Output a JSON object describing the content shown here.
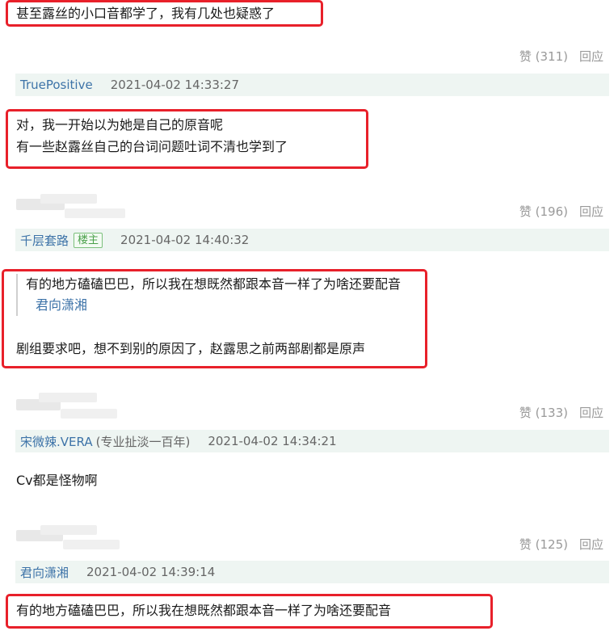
{
  "top_comment": {
    "text": "甚至露丝的小口音都学了，我有几处也疑惑了",
    "likes": "赞 (311)",
    "reply": "回应"
  },
  "comments": [
    {
      "author": "TruePositive",
      "time": "2021-04-02 14:33:27",
      "lines": [
        "对，我一开始以为她是自己的原音呢",
        "有一些赵露丝自己的台词问题吐词不清也学到了"
      ],
      "likes": "赞 (196)",
      "reply": "回应"
    },
    {
      "author": "千层套路",
      "badge": "楼主",
      "time": "2021-04-02 14:40:32",
      "quote_text": "有的地方磕磕巴巴，所以我在想既然都跟本音一样了为啥还要配音",
      "quote_author": "君向潇湘",
      "lines": [
        "剧组要求吧，想不到别的原因了，赵露思之前两部剧都是原声"
      ],
      "likes": "赞 (133)",
      "reply": "回应"
    },
    {
      "author": "宋微辣.VERA",
      "author_extra": "(专业扯淡一百年)",
      "time": "2021-04-02 14:34:21",
      "lines": [
        "Cv都是怪物啊"
      ],
      "likes": "赞 (125)",
      "reply": "回应"
    },
    {
      "author": "君向潇湘",
      "time": "2021-04-02 14:39:14",
      "lines": [
        "有的地方磕磕巴巴，所以我在想既然都跟本音一样了为啥还要配音"
      ]
    }
  ],
  "colors": {
    "highlight": "#e8202a",
    "author_link": "#3d73a8",
    "author_bar": "#eef5f2",
    "badge": "#4aa04a"
  }
}
